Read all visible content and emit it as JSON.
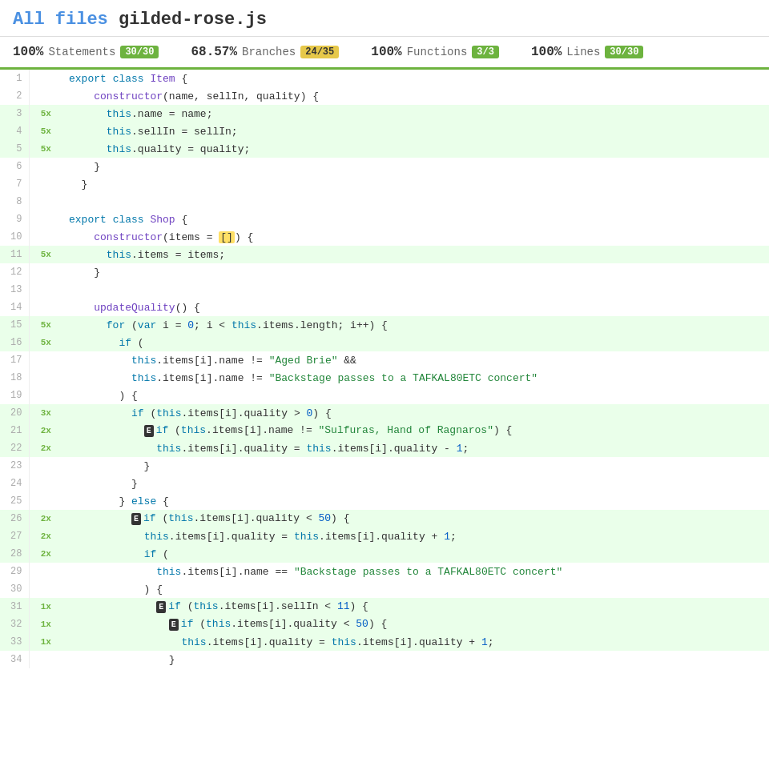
{
  "header": {
    "all_files_label": "All files",
    "filename": "gilded-rose.js"
  },
  "stats": [
    {
      "pct": "100%",
      "label": "Statements",
      "badge": "30/30",
      "partial": false
    },
    {
      "pct": "68.57%",
      "label": "Branches",
      "badge": "24/35",
      "partial": true
    },
    {
      "pct": "100%",
      "label": "Functions",
      "badge": "3/3",
      "partial": false
    },
    {
      "pct": "100%",
      "label": "Lines",
      "badge": "30/30",
      "partial": false
    }
  ]
}
